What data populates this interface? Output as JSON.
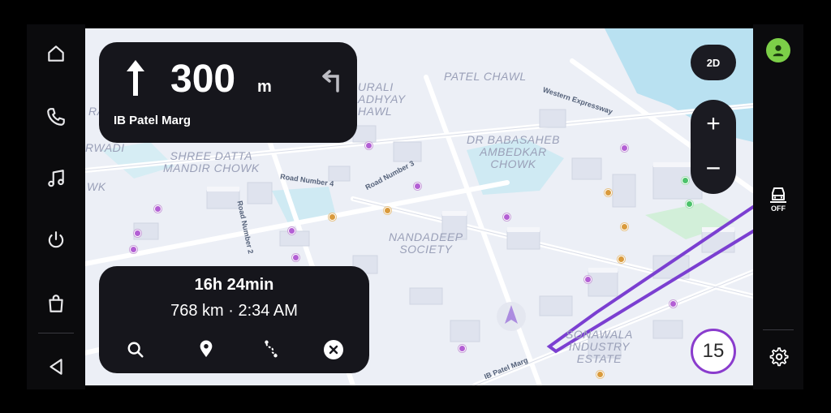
{
  "left_rail": {
    "icons": [
      "home-icon",
      "phone-icon",
      "music-icon",
      "power-icon",
      "bag-icon",
      "back-icon"
    ]
  },
  "navigation": {
    "distance_value": "300",
    "distance_unit": "m",
    "street": "IB Patel Marg",
    "primary_icon": "arrow-up-icon",
    "next_icon": "turn-left-icon"
  },
  "trip": {
    "duration": "16h 24min",
    "distance_eta": "768 km · 2:34 AM",
    "actions": [
      "search-icon",
      "location-pin-icon",
      "route-icon",
      "close-icon"
    ]
  },
  "map_controls": {
    "view_mode": "2D",
    "zoom_in": "+",
    "zoom_out": "−"
  },
  "speed_limit": "15",
  "right_rail": {
    "traffic_label": "OFF",
    "avatar_icon": "avatar-icon",
    "settings_icon": "gear-icon"
  },
  "map_labels": {
    "shree_datta": "SHREE DATTA\nMANDIR CHOWK",
    "patel_chawl": "PATEL CHAWL",
    "ambedkar": "DR BABASAHEB\nAMBEDKAR\nCHOWK",
    "nandadeep": "NANDADEEP\nSOCIETY",
    "sonawala": "SONAWALA\nINDUSTRY\nESTATE",
    "murali": "URALI\nADHYAY\nHAWL",
    "rang": "RANG",
    "wadi": "RWADI",
    "wk": "WK",
    "road_number_4": "Road Number 4",
    "road_number_3": "Road Number 3",
    "road_number_2": "Road Number 2",
    "western_expressway": "Western Expressway",
    "ib_patel_marg": "IB Patel Marg"
  },
  "colors": {
    "panel_bg": "#16161c",
    "route": "#7b3fd1",
    "avatar": "#7ccf48",
    "speed_ring": "#8a3ccd"
  }
}
